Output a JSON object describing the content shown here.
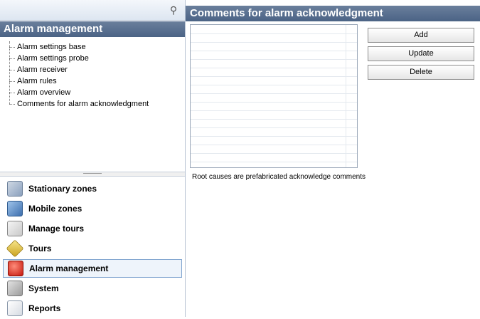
{
  "left_panel": {
    "title": "Alarm management",
    "pin_icon": "pin-icon",
    "tree": [
      {
        "label": "Alarm settings base"
      },
      {
        "label": "Alarm settings probe"
      },
      {
        "label": "Alarm receiver"
      },
      {
        "label": "Alarm rules"
      },
      {
        "label": "Alarm overview"
      },
      {
        "label": "Comments for alarm acknowledgment"
      }
    ],
    "nav": [
      {
        "label": "Stationary zones",
        "icon": "building-icon"
      },
      {
        "label": "Mobile zones",
        "icon": "vehicle-icon"
      },
      {
        "label": "Manage tours",
        "icon": "calendar-icon"
      },
      {
        "label": "Tours",
        "icon": "tour-sign-icon"
      },
      {
        "label": "Alarm management",
        "icon": "alarm-icon",
        "active": true
      },
      {
        "label": "System",
        "icon": "wrench-icon"
      },
      {
        "label": "Reports",
        "icon": "report-icon"
      }
    ]
  },
  "main": {
    "title": "Comments for alarm acknowledgment",
    "buttons": {
      "add": "Add",
      "update": "Update",
      "delete": "Delete"
    },
    "hint": "Root causes are prefabricated acknowledge comments"
  },
  "colors": {
    "title_bar": "#4b6385",
    "active_nav_border": "#7da2ce"
  }
}
